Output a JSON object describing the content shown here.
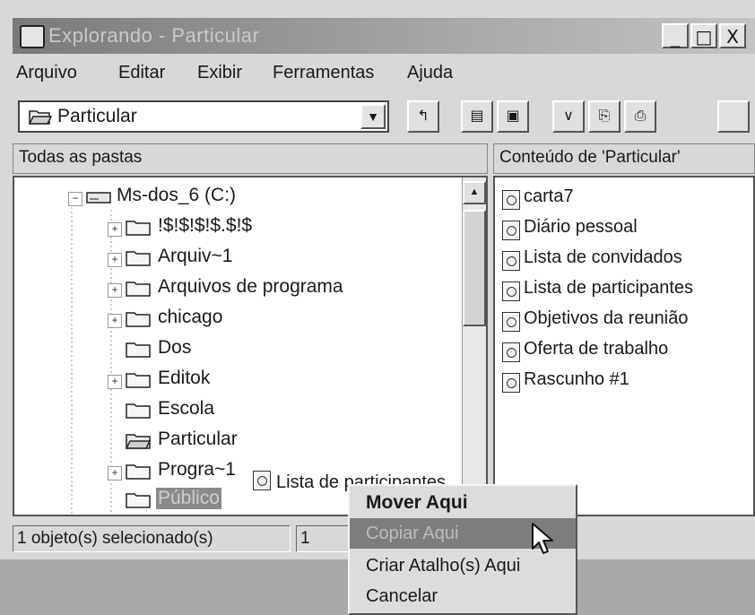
{
  "window": {
    "title": "Explorando - Particular",
    "controls": [
      "_",
      "□",
      "X"
    ]
  },
  "menu": [
    {
      "label": "Arquivo",
      "accel": "A"
    },
    {
      "label": "Editar",
      "accel": "E"
    },
    {
      "label": "Exibir",
      "accel": "x"
    },
    {
      "label": "Ferramentas",
      "accel": "F"
    },
    {
      "label": "Ajuda",
      "accel": "j"
    }
  ],
  "toolbar": {
    "location": "Particular"
  },
  "panes": {
    "left_header": "Todas as pastas",
    "right_header": "Conteúdo de 'Particular'"
  },
  "tree": {
    "drive": "Ms-dos_6 (C:)",
    "folders": [
      "!$!$!$!$.$!$",
      "Arquiv~1",
      "Arquivos de programa",
      "chicago",
      "Dos",
      "Editok",
      "Escola",
      "Particular",
      "Progra~1",
      "Público"
    ]
  },
  "drag_item": "Lista de participantes",
  "contents": [
    "carta7",
    "Diário pessoal",
    "Lista de convidados",
    "Lista de participantes",
    "Objetivos da reunião",
    "Oferta de trabalho",
    "Rascunho #1"
  ],
  "context_menu": [
    {
      "label": "Mover Aqui",
      "accel": "M",
      "default": true
    },
    {
      "label": "Copiar Aqui",
      "accel": "C",
      "highlighted": true
    },
    {
      "label": "Criar Atalho(s) Aqui",
      "accel": "A"
    },
    {
      "label": "Cancelar",
      "accel": ""
    }
  ],
  "status": {
    "selection": "1 objeto(s) selecionado(s)",
    "count": "1"
  },
  "colors": {
    "title_gradient_start": "#7a7a7a",
    "menu_highlight": "#7d7d7d",
    "window_face": "#d8d8d8"
  }
}
